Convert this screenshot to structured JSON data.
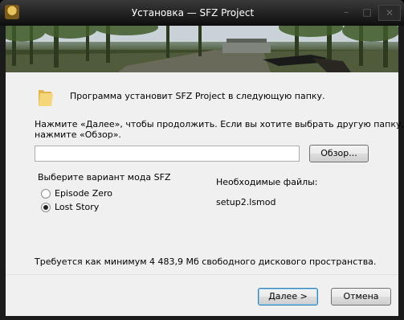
{
  "window": {
    "title": "Установка — SFZ Project"
  },
  "main": {
    "install_message": "Программа установит SFZ Project в следующую папку.",
    "instructions_line1": "Нажмите «Далее», чтобы продолжить. Если вы хотите выбрать другую папку,",
    "instructions_line2": "нажмите «Обзор».",
    "path_value": "",
    "browse_label": "Обзор...",
    "mode_heading": "Выберите вариант мода SFZ",
    "modes": [
      {
        "label": "Episode Zero",
        "selected": false
      },
      {
        "label": "Lost Story",
        "selected": true
      }
    ],
    "required_files_heading": "Необходимые файлы:",
    "required_file": "setup2.lsmod",
    "disk_space": "Требуется как минимум 4 483,9 Мб свободного дискового пространства."
  },
  "footer": {
    "next_label": "Далее >",
    "cancel_label": "Отмена"
  },
  "icons": {
    "app": "game-app-icon",
    "folder": "folder-icon",
    "minimize": "minimize-icon",
    "maximize": "maximize-icon",
    "close": "close-icon"
  }
}
